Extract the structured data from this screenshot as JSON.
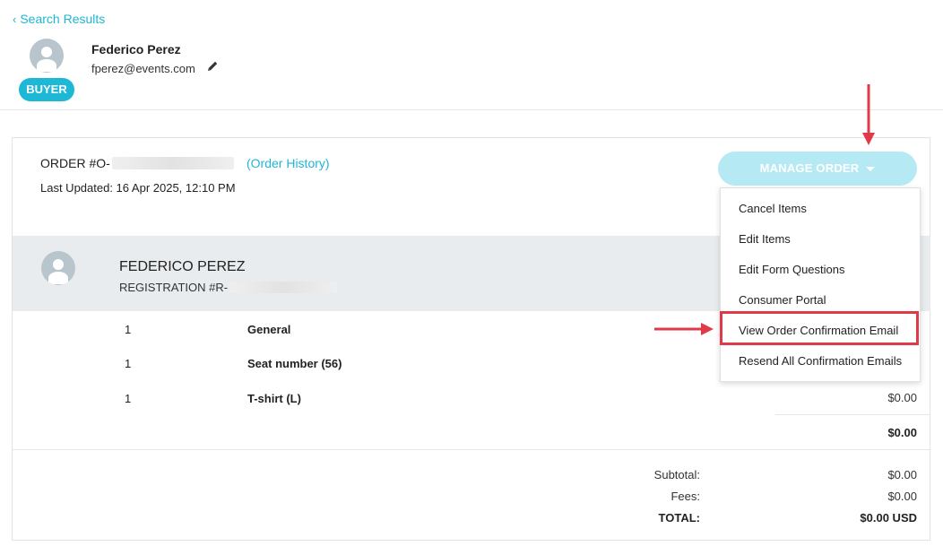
{
  "nav": {
    "back_label": "Search Results"
  },
  "buyer": {
    "name": "Federico Perez",
    "email": "fperez@events.com",
    "badge": "BUYER"
  },
  "order": {
    "number_prefix": "ORDER #O-",
    "history_link": "(Order History)",
    "last_updated": "Last Updated: 16 Apr 2025, 12:10 PM",
    "manage_label": "MANAGE ORDER"
  },
  "manage_menu": {
    "items": [
      "Cancel Items",
      "Edit Items",
      "Edit Form Questions",
      "Consumer Portal",
      "View Order Confirmation Email",
      "Resend All Confirmation Emails"
    ],
    "highlighted": "View Order Confirmation Email"
  },
  "registration": {
    "name": "FEDERICO PEREZ",
    "number_prefix": "REGISTRATION #R-"
  },
  "line_items": [
    {
      "qty": "1",
      "name": "General"
    },
    {
      "qty": "1",
      "name": "Seat number (56)"
    },
    {
      "qty": "1",
      "name": "T-shirt (L)",
      "price": "$0.00"
    }
  ],
  "registration_total": "$0.00",
  "summary": {
    "subtotal_label": "Subtotal:",
    "subtotal": "$0.00",
    "fees_label": "Fees:",
    "fees": "$0.00",
    "total_label": "TOTAL:",
    "total": "$0.00 USD"
  },
  "colors": {
    "accent": "#1fb6d2",
    "annotation": "#e03a48",
    "band": "#e9ecee"
  }
}
